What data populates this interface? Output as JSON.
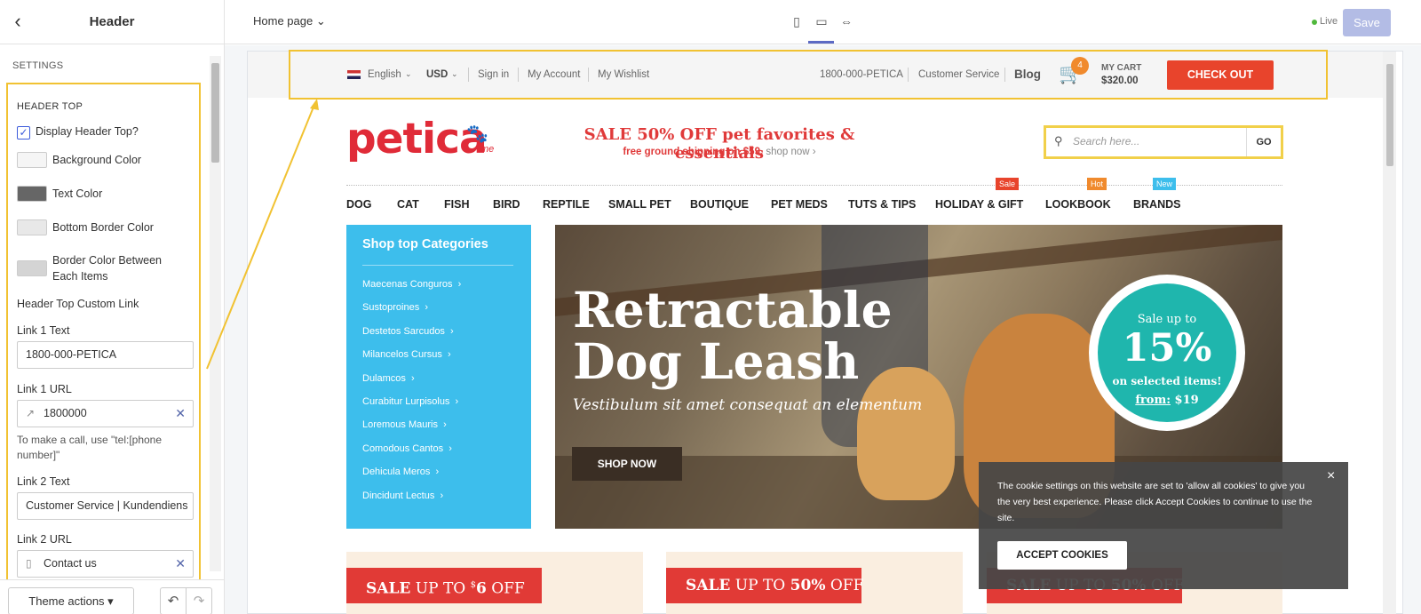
{
  "sidebar": {
    "back_icon": "chevron-left-icon",
    "title": "Header",
    "section_label": "SETTINGS",
    "group_title": "HEADER TOP",
    "display_checkbox_label": "Display Header Top?",
    "display_checked": true,
    "colors": [
      {
        "label": "Background Color",
        "hex": "#f5f5f5"
      },
      {
        "label": "Text Color",
        "hex": "#666666"
      },
      {
        "label": "Bottom Border Color",
        "hex": "#e8e8e8"
      },
      {
        "label": "Border Color Between Each Items",
        "hex": "#d4d4d4"
      }
    ],
    "custom_link_heading": "Header Top Custom Link",
    "link1_text_label": "Link 1 Text",
    "link1_text_value": "1800-000-PETICA",
    "link1_url_label": "Link 1 URL",
    "link1_url_value": "1800000",
    "link1_help": "To make a call, use \"tel:[phone number]\"",
    "link2_text_label": "Link 2 Text",
    "link2_text_value": "Customer Service | Kundendiens",
    "link2_url_label": "Link 2 URL",
    "link2_url_value": "Contact us",
    "theme_actions_label": "Theme actions"
  },
  "topbar": {
    "page_select": "Home page",
    "live_label": "Live",
    "save_label": "Save"
  },
  "store": {
    "header_top": {
      "language": "English",
      "currency": "USD",
      "sign_in": "Sign in",
      "my_account": "My Account",
      "my_wishlist": "My Wishlist",
      "phone": "1800-000-PETICA",
      "customer_service": "Customer Service",
      "blog": "Blog",
      "cart_count": "4",
      "cart_label": "MY CART",
      "cart_total": "$320.00",
      "checkout": "CHECK OUT"
    },
    "logo": "petica",
    "logo_suffix": "me",
    "sale_title": "SALE 50% OFF pet favorites & essentials",
    "sale_sub": "free ground shipping on $59.",
    "sale_link": "shop now ›",
    "search_placeholder": "Search here...",
    "search_go": "GO",
    "nav": [
      "DOG",
      "CAT",
      "FISH",
      "BIRD",
      "REPTILE",
      "SMALL PET",
      "BOUTIQUE",
      "PET MEDS",
      "TUTS & TIPS",
      "HOLIDAY & GIFT",
      "LOOKBOOK",
      "BRANDS"
    ],
    "nav_tags": {
      "sale": "Sale",
      "hot": "Hot",
      "new": "New"
    },
    "tag_colors": {
      "sale": "#e8442c",
      "hot": "#f08a2d",
      "new": "#3dbeec"
    },
    "categories_title": "Shop top Categories",
    "categories": [
      "Maecenas Conguros",
      "Sustoproines",
      "Destetos Sarcudos",
      "Milancelos Cursus",
      "Dulamcos",
      "Curabitur Lurpisolus",
      "Loremous Mauris",
      "Comodous Cantos",
      "Dehicula Meros",
      "Dincidunt Lectus"
    ],
    "hero_title_1": "Retractable",
    "hero_title_2": "Dog Leash",
    "hero_sub": "Vestibulum sit amet consequat an elementum",
    "hero_button": "SHOP NOW",
    "badge_l1": "Sale up to",
    "badge_l2": "15%",
    "badge_l3": "on selected items!",
    "badge_from": "from:",
    "badge_price": "$19",
    "promos": [
      {
        "prefix": "SALE",
        "mid": "UP TO",
        "sup": "$",
        "value": "6",
        "suffix": "OFF"
      },
      {
        "prefix": "SALE",
        "mid": "UP TO",
        "sup": "",
        "value": "50%",
        "suffix": "OFF"
      },
      {
        "prefix": "SALE",
        "mid": "UP TO",
        "sup": "",
        "value": "50%",
        "suffix": "OFF"
      }
    ]
  },
  "cookie": {
    "text": "The cookie settings on this website are set to 'allow all cookies' to give you the very best experience. Please click Accept Cookies to continue to use the site.",
    "accept": "ACCEPT COOKIES",
    "close": "×"
  },
  "colors": {
    "accent": "#f1c232",
    "checkout": "#e8442c",
    "primary": "#5c6ac4"
  }
}
